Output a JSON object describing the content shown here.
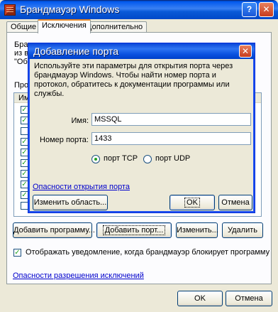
{
  "window": {
    "title": "Брандмауэр Windows",
    "icon": "firewall-icon"
  },
  "tabs": [
    {
      "label": "Общие",
      "active": false
    },
    {
      "label": "Исключения",
      "active": true
    },
    {
      "label": "Дополнительно",
      "active": false
    }
  ],
  "background": {
    "desc_line1": "Бранд",
    "desc_line2": "из вн",
    "desc_line3": "\"Общ",
    "programs_label": "Прогр",
    "list_header": "Им",
    "checkboxes": [
      true,
      true,
      false,
      true,
      true,
      true,
      true,
      true,
      true,
      false
    ]
  },
  "buttons": {
    "add_program": "Добавить программу...",
    "add_port": "Добавить порт...",
    "edit": "Изменить...",
    "delete": "Удалить"
  },
  "notify": {
    "checked": true,
    "label": "Отображать уведомление, когда брандмауэр блокирует программу"
  },
  "exceptions_link": "Опасности разрешения исключений",
  "footer": {
    "ok": "OK",
    "cancel": "Отмена"
  },
  "dialog": {
    "title": "Добавление порта",
    "description": "Используйте эти параметры для открытия порта через брандмауэр Windows. Чтобы найти номер порта и протокол, обратитесь к документации программы или службы.",
    "name_label": "Имя:",
    "name_value": "MSSQL",
    "port_label": "Номер порта:",
    "port_value": "1433",
    "tcp_label": "порт TCP",
    "udp_label": "порт UDP",
    "protocol_selected": "TCP",
    "danger_link": "Опасности открытия порта",
    "change_scope": "Изменить область...",
    "ok": "OK",
    "cancel": "Отмена"
  }
}
